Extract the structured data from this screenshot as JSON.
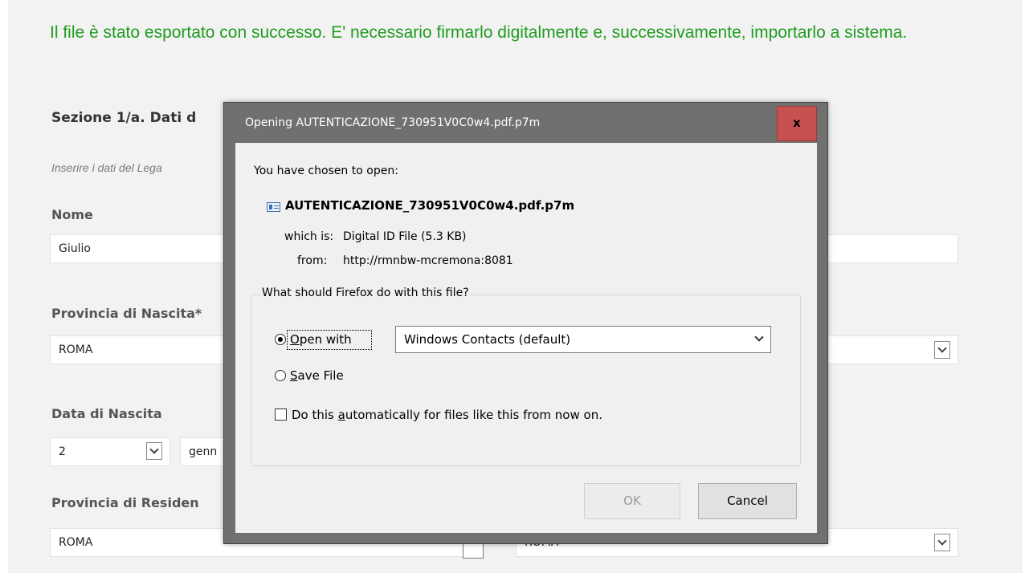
{
  "page": {
    "success_message": "Il file è stato esportato con successo. E' necessario firmarlo digitalmente e, successivamente, importarlo a sistema.",
    "section_title": "Sezione 1/a. Dati d",
    "hint": "Inserire i dati del Lega",
    "fields": {
      "nome_label": "Nome",
      "nome_value": "Giulio",
      "provincia_nascita_label": "Provincia di Nascita*",
      "provincia_nascita_value": "ROMA",
      "data_nascita_label": "Data di Nascita",
      "giorno_value": "2",
      "mese_value": "genn",
      "provincia_residenza_label": "Provincia di Residen",
      "provincia_residenza_value": "ROMA",
      "comune_residenza_value": "ROMA"
    }
  },
  "dialog": {
    "title": "Opening AUTENTICAZIONE_730951V0C0w4.pdf.p7m",
    "close_label": "x",
    "chosen_text": "You have chosen to open:",
    "file_name": "AUTENTICAZIONE_730951V0C0w4.pdf.p7m",
    "which_is_label": "which is:",
    "which_is_value": "Digital ID File (5.3 KB)",
    "from_label": "from:",
    "from_value": "http://rmnbw-mcremona:8081",
    "group_legend": "What should Firefox do with this file?",
    "open_with": {
      "pre": "",
      "key": "O",
      "post": "pen with"
    },
    "open_with_app": "Windows Contacts (default)",
    "save_file": {
      "pre": "",
      "key": "S",
      "post": "ave File"
    },
    "auto_text": {
      "pre": "Do this ",
      "key": "a",
      "post": "utomatically for files like this from now on."
    },
    "ok_label": "OK",
    "cancel_label": "Cancel",
    "selected_option": "open_with",
    "auto_checked": false
  },
  "colors": {
    "success": "#1f9c1f",
    "close_button": "#c75050",
    "dialog_frame": "#707070"
  }
}
